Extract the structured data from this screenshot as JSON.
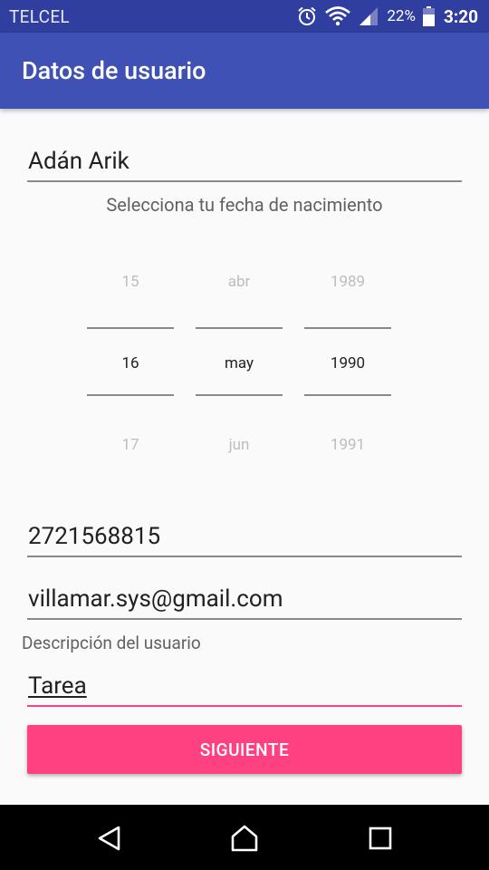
{
  "status_bar": {
    "carrier": "TELCEL",
    "battery": "22%",
    "time": "3:20",
    "icons": [
      "alarm-icon",
      "wifi-icon",
      "signal-icon",
      "battery-icon"
    ]
  },
  "app_bar": {
    "title": "Datos de usuario"
  },
  "form": {
    "name": "Adán Arik",
    "date_label": "Selecciona tu fecha de nacimiento",
    "date_picker": {
      "day": {
        "prev": "15",
        "selected": "16",
        "next": "17"
      },
      "month": {
        "prev": "abr",
        "selected": "may",
        "next": "jun"
      },
      "year": {
        "prev": "1989",
        "selected": "1990",
        "next": "1991"
      }
    },
    "phone": "2721568815",
    "email": "villamar.sys@gmail.com",
    "description_label": "Descripción del usuario",
    "description": "Tarea",
    "next_button": "SIGUIENTE"
  },
  "nav_bar": {
    "icons": [
      "back-icon",
      "home-icon",
      "recent-apps-icon"
    ]
  },
  "colors": {
    "primary": "#3f51b5",
    "primary_dark": "#303f9f",
    "accent": "#ff4081",
    "background": "#fafafa"
  }
}
